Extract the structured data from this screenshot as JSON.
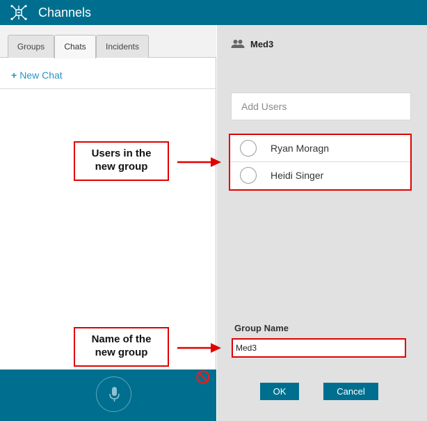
{
  "header": {
    "title": "Channels",
    "logo_icon": "network-hub-icon"
  },
  "left_panel": {
    "tabs": [
      {
        "label": "Groups",
        "active": false
      },
      {
        "label": "Chats",
        "active": true
      },
      {
        "label": "Incidents",
        "active": false
      }
    ],
    "new_chat": {
      "plus": "+",
      "label": "New Chat"
    },
    "footer": {
      "mic_icon": "microphone-icon",
      "status_icon": "no-entry-icon"
    }
  },
  "right_panel": {
    "group_icon": "people-icon",
    "group_title": "Med3",
    "add_users_placeholder": "Add Users",
    "users": [
      {
        "name": "Ryan Moragn",
        "selected": false
      },
      {
        "name": "Heidi Singer",
        "selected": false
      }
    ],
    "group_name_label": "Group Name",
    "group_name_value": "Med3",
    "ok_label": "OK",
    "cancel_label": "Cancel"
  },
  "callouts": {
    "users_line1": "Users in the",
    "users_line2": "new group",
    "name_line1": "Name of the",
    "name_line2": "new group"
  },
  "colors": {
    "header": "#006f8f",
    "accent_link": "#2a95c4",
    "callout_border": "#e00000",
    "panel_bg": "#e1e1e1"
  }
}
